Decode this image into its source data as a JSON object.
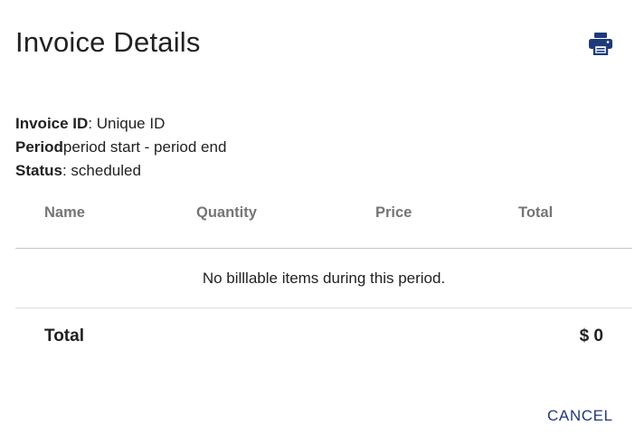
{
  "dialog": {
    "title": "Invoice Details",
    "print_icon": "printer-icon",
    "accent_color": "#1e3a7a"
  },
  "meta": {
    "invoice_id_label": "Invoice ID",
    "invoice_id_value": ": Unique ID",
    "period_label": "Period",
    "period_value": "period start - period end",
    "status_label": "Status",
    "status_value": ": scheduled"
  },
  "table": {
    "columns": [
      "Name",
      "Quantity",
      "Price",
      "Total"
    ],
    "empty_message": "No billlable items during this period.",
    "total_label": "Total",
    "total_value": "$ 0"
  },
  "actions": {
    "cancel_label": "CANCEL"
  }
}
